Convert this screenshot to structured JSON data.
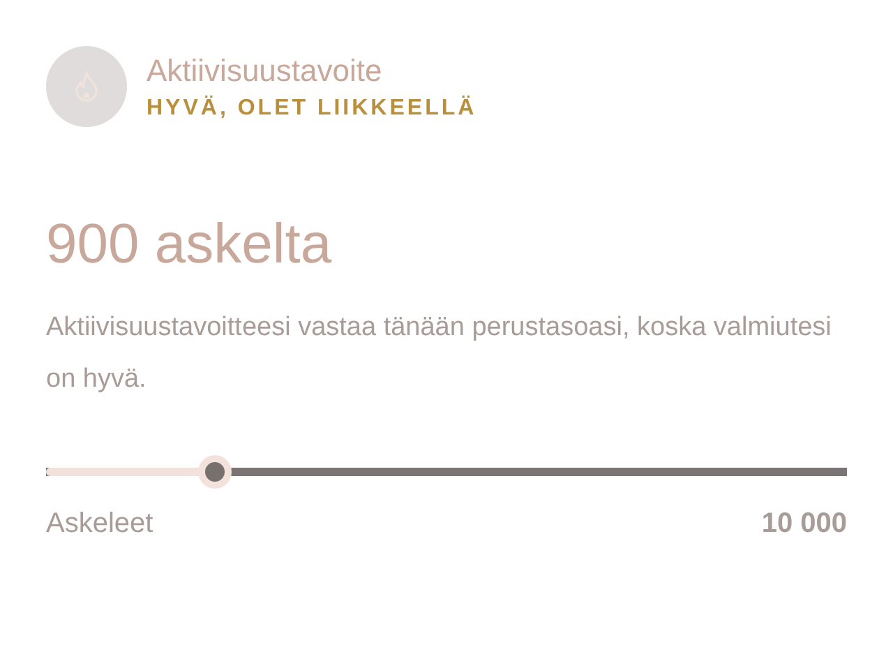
{
  "header": {
    "title": "Aktiivisuustavoite",
    "status": "HYVÄ, OLET LIIKKEELLÄ"
  },
  "goal": {
    "heading": "900 askelta",
    "description": "Aktiivisuustavoitteesi vastaa tänään perustasoasi, koska valmiutesi on hyvä."
  },
  "slider": {
    "level": 0.21,
    "label": "Askeleet",
    "max_label": "10 000"
  }
}
